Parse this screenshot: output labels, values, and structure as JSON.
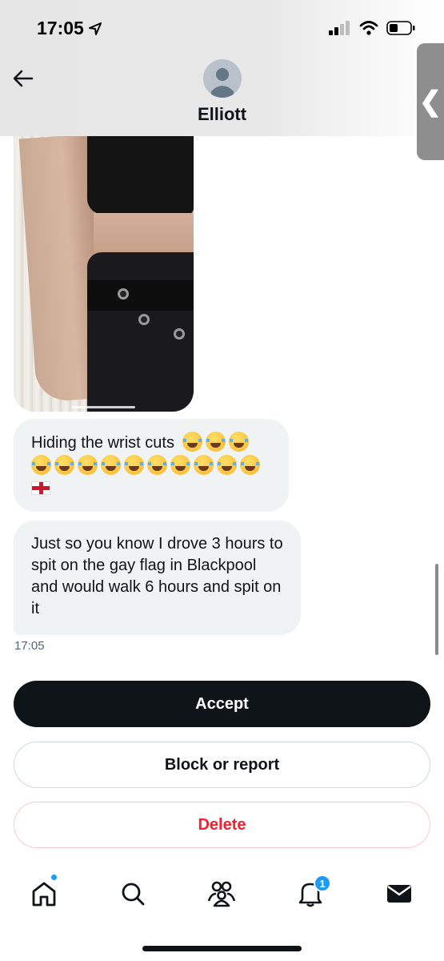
{
  "status_bar": {
    "time": "17:05",
    "icons": [
      "location-arrow-icon",
      "cellular-signal-icon",
      "wifi-icon",
      "battery-icon"
    ]
  },
  "header": {
    "contact_name": "Elliott",
    "back_icon": "back-arrow-icon",
    "avatar_icon": "default-avatar-icon"
  },
  "side_handle": {
    "glyph": "❮"
  },
  "conversation": {
    "photo": {
      "description_icon": "image-attachment"
    },
    "messages": [
      {
        "text": "Hiding the wrist cuts",
        "emoji_count_line1": 3,
        "emoji_count_line2": 10,
        "flag": "england-flag"
      },
      {
        "text": "Just so you know I drove 3 hours to spit on the gay flag in Blackpool and would walk 6 hours and spit on it"
      }
    ],
    "timestamp": "17:05"
  },
  "actions": {
    "accept_label": "Accept",
    "block_label": "Block or report",
    "delete_label": "Delete"
  },
  "bottom_nav": {
    "items": [
      {
        "name": "home",
        "icon": "home-icon",
        "has_dot": true
      },
      {
        "name": "search",
        "icon": "search-icon"
      },
      {
        "name": "communities",
        "icon": "communities-icon"
      },
      {
        "name": "notifications",
        "icon": "bell-icon",
        "badge": "1"
      },
      {
        "name": "messages",
        "icon": "envelope-icon"
      }
    ]
  },
  "colors": {
    "accent": "#1d9bf0",
    "primary_button": "#0f1419",
    "danger": "#f4212e",
    "bubble": "#eff3f4"
  }
}
